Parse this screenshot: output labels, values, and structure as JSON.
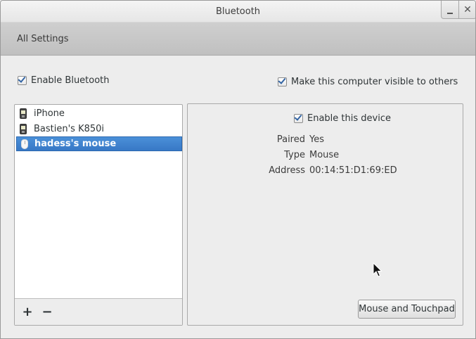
{
  "window": {
    "title": "Bluetooth",
    "minimize_icon": "minimize-icon",
    "close_label": "✕"
  },
  "nav": {
    "all_settings": "All Settings"
  },
  "options": {
    "enable_bluetooth": {
      "label": "Enable Bluetooth",
      "checked": true
    },
    "visible_to_others": {
      "label": "Make this computer visible to others",
      "checked": true
    }
  },
  "devices": [
    {
      "name": "iPhone",
      "icon": "phone-icon",
      "selected": false
    },
    {
      "name": "Bastien's K850i",
      "icon": "phone-icon",
      "selected": false
    },
    {
      "name": "hadess's mouse",
      "icon": "mouse-icon",
      "selected": true
    }
  ],
  "list_toolbar": {
    "add": "+",
    "remove": "−"
  },
  "details": {
    "enable_device": {
      "label": "Enable this device",
      "checked": true
    },
    "properties": [
      {
        "label": "Paired",
        "value": "Yes"
      },
      {
        "label": "Type",
        "value": "Mouse"
      },
      {
        "label": "Address",
        "value": "00:14:51:D1:69:ED"
      }
    ],
    "settings_button": "Mouse and Touchpad"
  },
  "colors": {
    "selection": "#3878c6",
    "checkmark": "#3465a4"
  }
}
